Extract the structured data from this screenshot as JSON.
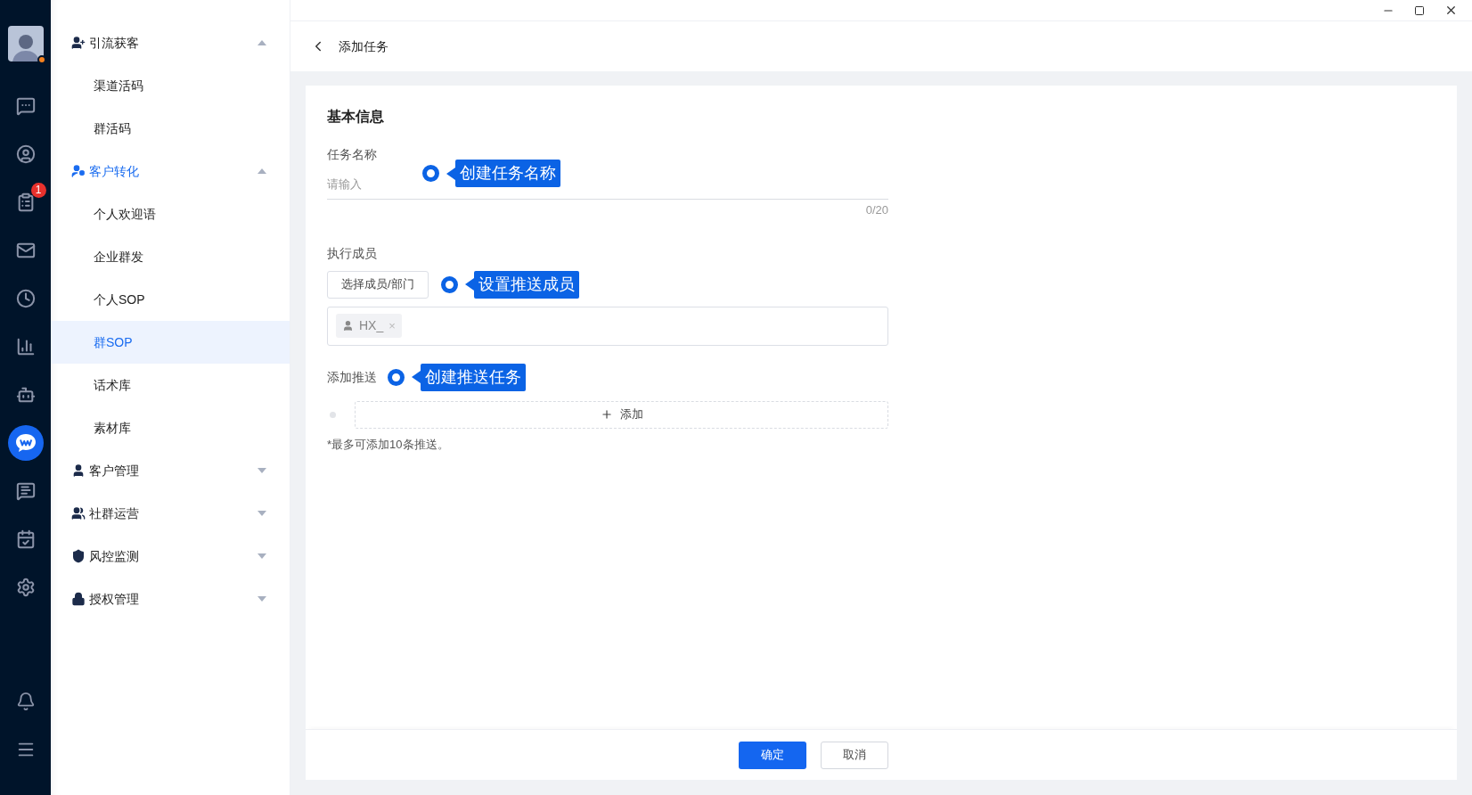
{
  "rail": {
    "items": [
      {
        "kind": "avatar"
      },
      {
        "kind": "chat"
      },
      {
        "kind": "contact"
      },
      {
        "kind": "task",
        "badge": "1"
      },
      {
        "kind": "mail"
      },
      {
        "kind": "clock"
      },
      {
        "kind": "chart"
      },
      {
        "kind": "robot"
      },
      {
        "kind": "wecom"
      },
      {
        "kind": "message"
      },
      {
        "kind": "board"
      },
      {
        "kind": "settings"
      }
    ],
    "bottom": [
      {
        "kind": "bell"
      },
      {
        "kind": "menu"
      }
    ]
  },
  "sidebar": {
    "groups": [
      {
        "label": "引流获客",
        "kind": "user-plus",
        "active": false,
        "expanded": true,
        "children": [
          {
            "label": "渠道活码",
            "selected": false
          },
          {
            "label": "群活码",
            "selected": false
          }
        ]
      },
      {
        "label": "客户转化",
        "kind": "user-cog",
        "active": true,
        "expanded": true,
        "children": [
          {
            "label": "个人欢迎语",
            "selected": false
          },
          {
            "label": "企业群发",
            "selected": false
          },
          {
            "label": "个人SOP",
            "selected": false
          },
          {
            "label": "群SOP",
            "selected": true
          },
          {
            "label": "话术库",
            "selected": false
          },
          {
            "label": "素材库",
            "selected": false
          }
        ]
      },
      {
        "label": "客户管理",
        "kind": "user",
        "active": false,
        "expanded": false
      },
      {
        "label": "社群运营",
        "kind": "users",
        "active": false,
        "expanded": false
      },
      {
        "label": "风控监测",
        "kind": "shield",
        "active": false,
        "expanded": false
      },
      {
        "label": "授权管理",
        "kind": "lock",
        "active": false,
        "expanded": false
      }
    ]
  },
  "header": {
    "title": "添加任务"
  },
  "form": {
    "section_title": "基本信息",
    "task_name": {
      "label": "任务名称",
      "placeholder": "请输入",
      "counter": "0/20",
      "callout": "创建任务名称"
    },
    "members": {
      "label": "执行成员",
      "button": "选择成员/部门",
      "callout": "设置推送成员",
      "tags": [
        {
          "label": "HX_",
          "close": "×"
        }
      ]
    },
    "push": {
      "label": "添加推送",
      "callout": "创建推送任务",
      "add_button": "添加",
      "note": "*最多可添加10条推送。"
    }
  },
  "footer": {
    "buttons": [
      {
        "label": "确定",
        "kind": "primary"
      },
      {
        "label": "取消",
        "kind": "default"
      }
    ]
  }
}
